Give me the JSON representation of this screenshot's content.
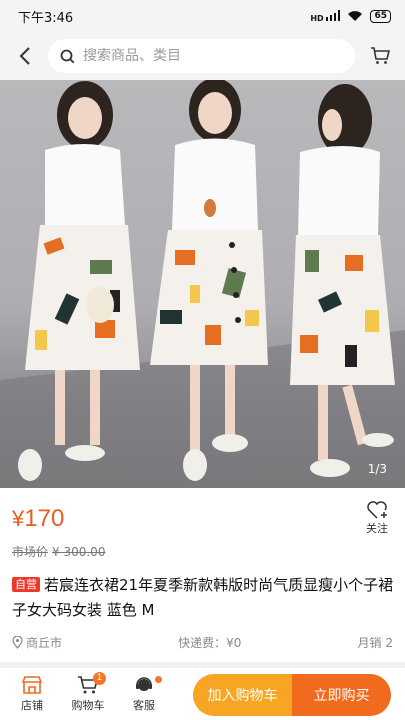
{
  "status_bar": {
    "time": "下午3:46",
    "signal_text": "HD",
    "battery": "65"
  },
  "search": {
    "placeholder": "搜索商品、类目"
  },
  "product": {
    "image_counter": "1/3",
    "currency": "¥",
    "price": "170",
    "market_price_label": "市场价",
    "market_price_value": "¥ 300.00",
    "follow_label": "关注",
    "self_operated_badge": "自营",
    "title": "若宸连衣裙21年夏季新款韩版时尚气质显瘦小个子裙子女大码女装 蓝色 M",
    "location": "商丘市",
    "shipping": "快递费：¥0",
    "monthly_sales": "月销 2"
  },
  "bottom_bar": {
    "shop_label": "店铺",
    "cart_label": "购物车",
    "cart_badge": "1",
    "service_label": "客服",
    "add_to_cart_label": "加入购物车",
    "buy_now_label": "立即购买"
  },
  "colors": {
    "accent": "#f06b1e",
    "price": "#ec5b22",
    "cart_button": "#f6a623",
    "badge_red": "#ea3a2c"
  }
}
